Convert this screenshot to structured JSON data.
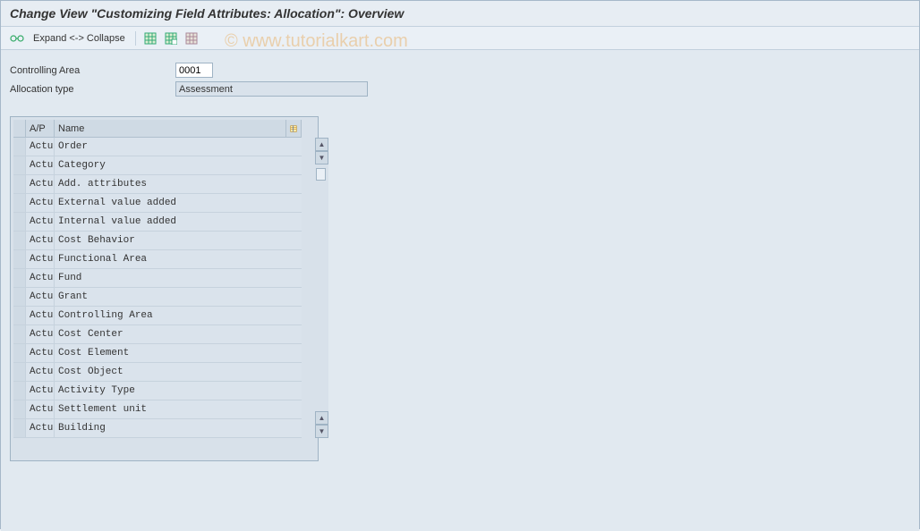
{
  "title": "Change View \"Customizing Field Attributes: Allocation\": Overview",
  "toolbar": {
    "expand_collapse": "Expand <-> Collapse"
  },
  "form": {
    "controlling_area_label": "Controlling Area",
    "controlling_area_value": "0001",
    "allocation_type_label": "Allocation type",
    "allocation_type_value": "Assessment"
  },
  "table": {
    "headers": {
      "ap": "A/P",
      "name": "Name"
    },
    "rows": [
      {
        "ap": "Actu",
        "name": "Order"
      },
      {
        "ap": "Actu",
        "name": "Category"
      },
      {
        "ap": "Actu",
        "name": "Add. attributes"
      },
      {
        "ap": "Actu",
        "name": "External value added"
      },
      {
        "ap": "Actu",
        "name": "Internal value added"
      },
      {
        "ap": "Actu",
        "name": "Cost Behavior"
      },
      {
        "ap": "Actu",
        "name": "Functional Area"
      },
      {
        "ap": "Actu",
        "name": "Fund"
      },
      {
        "ap": "Actu",
        "name": "Grant"
      },
      {
        "ap": "Actu",
        "name": "Controlling Area"
      },
      {
        "ap": "Actu",
        "name": "Cost Center"
      },
      {
        "ap": "Actu",
        "name": "Cost Element"
      },
      {
        "ap": "Actu",
        "name": "Cost Object"
      },
      {
        "ap": "Actu",
        "name": "Activity Type"
      },
      {
        "ap": "Actu",
        "name": "Settlement unit"
      },
      {
        "ap": "Actu",
        "name": "Building"
      }
    ]
  },
  "watermark": "© www.tutorialkart.com"
}
